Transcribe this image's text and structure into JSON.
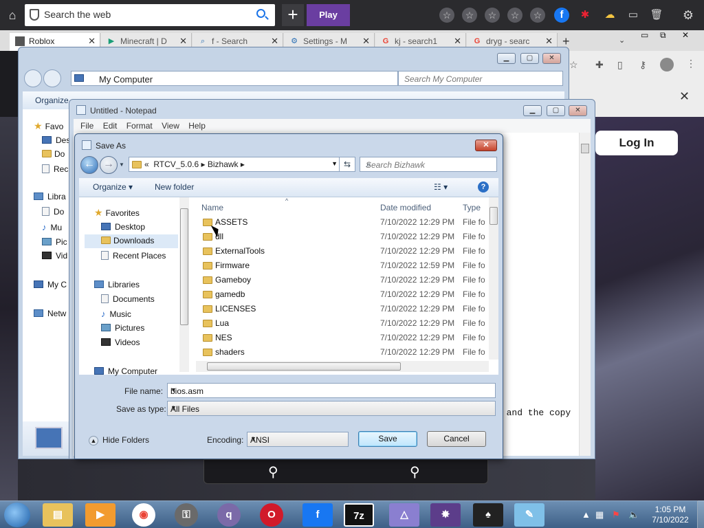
{
  "browser": {
    "search_placeholder": "Search the web",
    "play_label": "Play",
    "tabs": [
      {
        "label": "Roblox",
        "icon": "roblox-icon"
      },
      {
        "label": "Minecraft | D",
        "icon": "play-icon"
      },
      {
        "label": "f - Search",
        "icon": "search-icon"
      },
      {
        "label": "Settings - M",
        "icon": "gear-icon"
      },
      {
        "label": "kj - search1",
        "icon": "google-icon"
      },
      {
        "label": "dryg - searc",
        "icon": "google-icon"
      }
    ],
    "login_label": "Log In"
  },
  "explorer": {
    "address": "My Computer",
    "search_placeholder": "Search My Computer",
    "organize_label": "Organize",
    "sidebar": [
      "Favo",
      "Des",
      "Do",
      "Rec",
      "Libra",
      "Do",
      "Mu",
      "Pic",
      "Vid",
      "My C",
      "Netw"
    ]
  },
  "notepad": {
    "title": "Untitled - Notepad",
    "menu": [
      "File",
      "Edit",
      "Format",
      "View",
      "Help"
    ],
    "content_fragment": "n and the copy"
  },
  "save_as": {
    "title": "Save As",
    "breadcrumb_prefix": "«",
    "breadcrumb": [
      "RTCV_5.0.6",
      "Bizhawk"
    ],
    "search_placeholder": "Search Bizhawk",
    "organize_label": "Organize",
    "new_folder_label": "New folder",
    "nav_tree": [
      {
        "label": "Favorites",
        "kind": "star"
      },
      {
        "label": "Desktop",
        "kind": "pc"
      },
      {
        "label": "Downloads",
        "kind": "folder"
      },
      {
        "label": "Recent Places",
        "kind": "doc"
      },
      {
        "label": "Libraries",
        "kind": "lib"
      },
      {
        "label": "Documents",
        "kind": "doc"
      },
      {
        "label": "Music",
        "kind": "note"
      },
      {
        "label": "Pictures",
        "kind": "pic"
      },
      {
        "label": "Videos",
        "kind": "film"
      },
      {
        "label": "My Computer",
        "kind": "pc"
      }
    ],
    "columns": {
      "name": "Name",
      "date": "Date modified",
      "type": "Type"
    },
    "files": [
      {
        "name": "ASSETS",
        "date": "7/10/2022 12:29 PM",
        "type": "File fol"
      },
      {
        "name": "dll",
        "date": "7/10/2022 12:29 PM",
        "type": "File fol"
      },
      {
        "name": "ExternalTools",
        "date": "7/10/2022 12:29 PM",
        "type": "File fol"
      },
      {
        "name": "Firmware",
        "date": "7/10/2022 12:59 PM",
        "type": "File fol"
      },
      {
        "name": "Gameboy",
        "date": "7/10/2022 12:29 PM",
        "type": "File fol"
      },
      {
        "name": "gamedb",
        "date": "7/10/2022 12:29 PM",
        "type": "File fol"
      },
      {
        "name": "LICENSES",
        "date": "7/10/2022 12:29 PM",
        "type": "File fol"
      },
      {
        "name": "Lua",
        "date": "7/10/2022 12:29 PM",
        "type": "File fol"
      },
      {
        "name": "NES",
        "date": "7/10/2022 12:29 PM",
        "type": "File fol"
      },
      {
        "name": "shaders",
        "date": "7/10/2022 12:29 PM",
        "type": "File fol"
      }
    ],
    "file_name_label": "File name:",
    "file_name_value": "bios.asm",
    "save_type_label": "Save as type:",
    "save_type_value": "All Files",
    "hide_folders_label": "Hide Folders",
    "encoding_label": "Encoding:",
    "encoding_value": "ANSI",
    "save_label": "Save",
    "cancel_label": "Cancel"
  },
  "taskbar": {
    "time": "1:05 PM",
    "date": "7/10/2022",
    "apps": [
      "explorer-icon",
      "media-player-icon",
      "chrome-icon",
      "keepass-icon",
      "qbittorrent-icon",
      "opera-icon",
      "facebook-icon",
      "7zip-icon",
      "triangle-app-icon",
      "game-app-icon",
      "anonymous-icon",
      "notepad-icon"
    ],
    "app_labels": {
      "zip": "7z"
    }
  },
  "colors": {
    "accent_purple": "#6a3ea1",
    "dialog_frame": "#cad8ea",
    "close_red": "#c5432b",
    "taskbar": "#3d5f86"
  }
}
